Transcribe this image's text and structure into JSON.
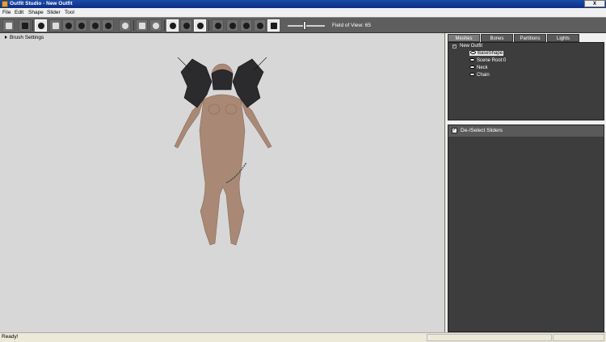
{
  "window": {
    "title": "Outfit Studio - New Outfit",
    "close_label": "X"
  },
  "menu": [
    "File",
    "Edit",
    "Shape",
    "Slider",
    "Tool"
  ],
  "toolbar": {
    "fov_label": "Field of View: 65"
  },
  "viewport": {
    "brush_settings_label": "Brush Settings"
  },
  "tabs": [
    "Meshes",
    "Bones",
    "Partitions",
    "Lights"
  ],
  "tree": {
    "root": "New Outfit",
    "expander": "−",
    "items": [
      "BaseShape",
      "Scene Root:0",
      "Neck",
      "Chain"
    ],
    "selected": "BaseShape"
  },
  "sliders": {
    "header_label": "De-/Select Sliders",
    "checked": true,
    "check_mark": "✓"
  },
  "status": {
    "text": "Ready!"
  }
}
